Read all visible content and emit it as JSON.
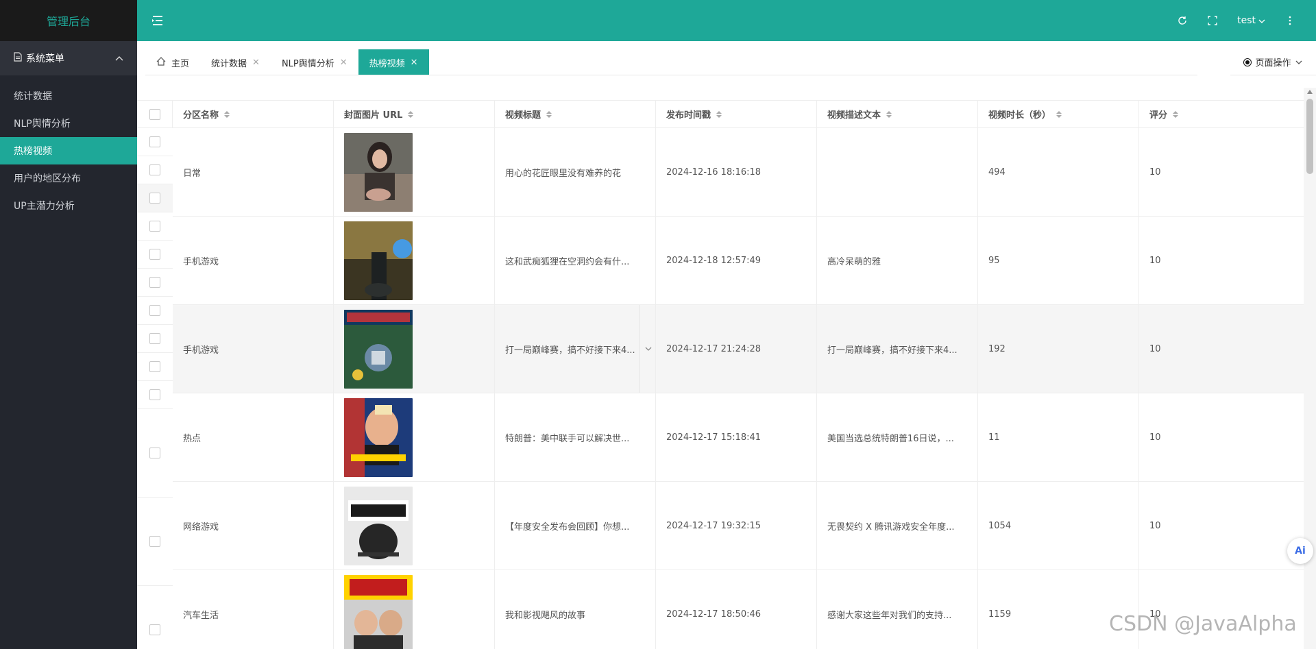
{
  "app": {
    "title": "管理后台"
  },
  "sidebar": {
    "group_label": "系统菜单",
    "items": [
      {
        "label": "统计数据"
      },
      {
        "label": "NLP舆情分析"
      },
      {
        "label": "热榜视频",
        "active": true
      },
      {
        "label": "用户的地区分布"
      },
      {
        "label": "UP主潜力分析"
      }
    ]
  },
  "header": {
    "user": "test"
  },
  "tabs": [
    {
      "label": "主页",
      "closable": false
    },
    {
      "label": "统计数据",
      "closable": true
    },
    {
      "label": "NLP舆情分析",
      "closable": true
    },
    {
      "label": "热榜视频",
      "closable": true,
      "active": true
    }
  ],
  "page_ops_label": "页面操作",
  "table": {
    "columns": [
      "分区名称",
      "封面图片 URL",
      "视频标题",
      "发布时间戳",
      "视频描述文本",
      "视频时长（秒）",
      "评分"
    ],
    "rows": [
      {
        "category": "日常",
        "title": "用心的花匠眼里没有难养的花",
        "time": "2024-12-16 18:16:18",
        "desc": "",
        "duration": "494",
        "score": "10"
      },
      {
        "category": "手机游戏",
        "title": "这和武痴狐狸在空洞约会有什...",
        "time": "2024-12-18 12:57:49",
        "desc": "高冷呆萌的雅",
        "duration": "95",
        "score": "10"
      },
      {
        "category": "手机游戏",
        "title": "打一局巅峰赛，搞不好接下来4...",
        "time": "2024-12-17 21:24:28",
        "desc": "打一局巅峰赛，搞不好接下来4...",
        "duration": "192",
        "score": "10"
      },
      {
        "category": "热点",
        "title": "特朗普：美中联手可以解决世...",
        "time": "2024-12-17 15:18:41",
        "desc": "美国当选总统特朗普16日说，...",
        "duration": "11",
        "score": "10"
      },
      {
        "category": "网络游戏",
        "title": "【年度安全发布会回顾】你想...",
        "time": "2024-12-17 19:32:15",
        "desc": "无畏契约 X 腾讯游戏安全年度...",
        "duration": "1054",
        "score": "10"
      },
      {
        "category": "汽车生活",
        "title": "我和影视飓风的故事",
        "time": "2024-12-17 18:50:46",
        "desc": "感谢大家这些年对我们的支持...",
        "duration": "1159",
        "score": "10"
      }
    ]
  },
  "ai_badge": "Ai",
  "watermark": "CSDN @JavaAlpha",
  "colors": {
    "accent": "#1ea898",
    "sidebar": "#23262e"
  }
}
